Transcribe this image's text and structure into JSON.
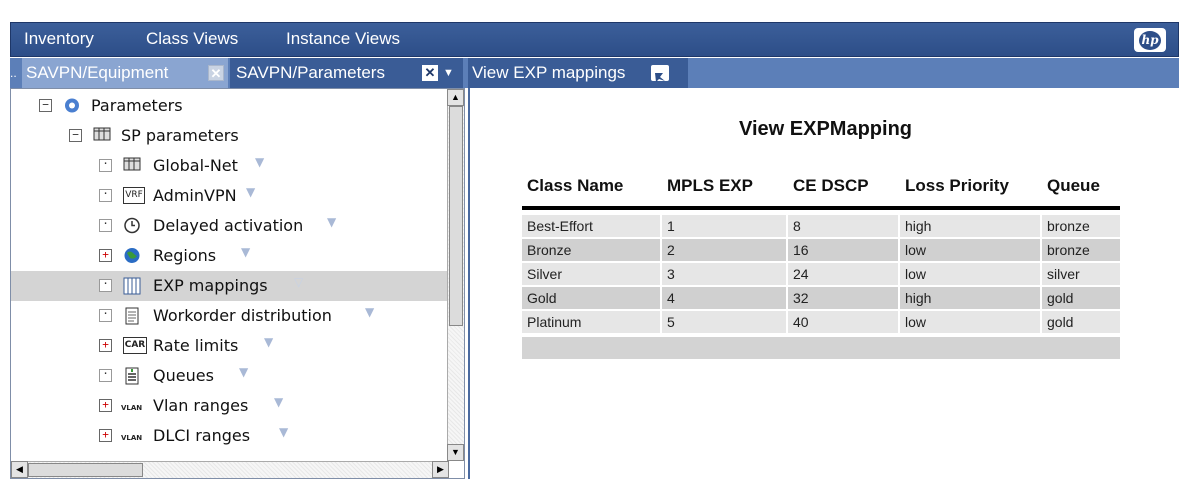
{
  "menubar": {
    "items": [
      "Inventory",
      "Class Views",
      "Instance Views"
    ],
    "logo_text": "hp"
  },
  "tabs": {
    "overflow_indicator": "..",
    "items": [
      {
        "label": "SAVPN/Equipment",
        "state": "inactive"
      },
      {
        "label": "SAVPN/Parameters",
        "state": "active"
      },
      {
        "label": "View EXP mappings",
        "state": "active"
      }
    ],
    "close_glyph": "✕",
    "dropdown_glyph": "▼"
  },
  "tree": {
    "nodes": [
      {
        "label": "Parameters",
        "expander": "−",
        "icon": "gear-icon",
        "level": 0
      },
      {
        "label": "SP parameters",
        "expander": "−",
        "icon": "table-icon",
        "level": 1
      },
      {
        "label": "Global-Net",
        "expander": "",
        "icon": "table-icon",
        "level": 2,
        "arrow": "▼"
      },
      {
        "label": "AdminVPN",
        "expander": "",
        "icon": "vrf-icon",
        "icon_text": "VRF",
        "level": 2,
        "arrow": "▼"
      },
      {
        "label": "Delayed activation",
        "expander": "",
        "icon": "clock-icon",
        "level": 2,
        "arrow": "▼"
      },
      {
        "label": "Regions",
        "expander": "+",
        "icon": "globe-icon",
        "level": 2,
        "arrow": "▼"
      },
      {
        "label": "EXP mappings",
        "expander": "",
        "icon": "columns-icon",
        "level": 2,
        "arrow": "▽",
        "selected": true
      },
      {
        "label": "Workorder distribution",
        "expander": "",
        "icon": "document-icon",
        "level": 2,
        "arrow": "▼"
      },
      {
        "label": "Rate limits",
        "expander": "+",
        "icon": "car-icon",
        "icon_text": "CAR",
        "level": 2,
        "arrow": "▼"
      },
      {
        "label": "Queues",
        "expander": "",
        "icon": "queue-icon",
        "level": 2,
        "arrow": "▼"
      },
      {
        "label": "Vlan ranges",
        "expander": "+",
        "icon": "vlan-icon",
        "icon_text": "VLAN",
        "level": 2,
        "arrow": "▼"
      },
      {
        "label": "DLCI ranges",
        "expander": "+",
        "icon": "vlan-icon",
        "icon_text": "VLAN",
        "level": 2,
        "arrow": "▼"
      }
    ]
  },
  "view": {
    "title": "View EXPMapping",
    "columns": [
      "Class Name",
      "MPLS EXP",
      "CE DSCP",
      "Loss Priority",
      "Queue"
    ],
    "rows": [
      [
        "Best-Effort",
        "1",
        "8",
        "high",
        "bronze"
      ],
      [
        "Bronze",
        "2",
        "16",
        "low",
        "bronze"
      ],
      [
        "Silver",
        "3",
        "24",
        "low",
        "silver"
      ],
      [
        "Gold",
        "4",
        "32",
        "high",
        "gold"
      ],
      [
        "Platinum",
        "5",
        "40",
        "low",
        "gold"
      ]
    ]
  },
  "colors": {
    "menubar": "#2d4e88",
    "tab_active": "#3a5c96",
    "tab_inactive": "#8aa5d1",
    "selected_row": "#d4d4d4"
  }
}
